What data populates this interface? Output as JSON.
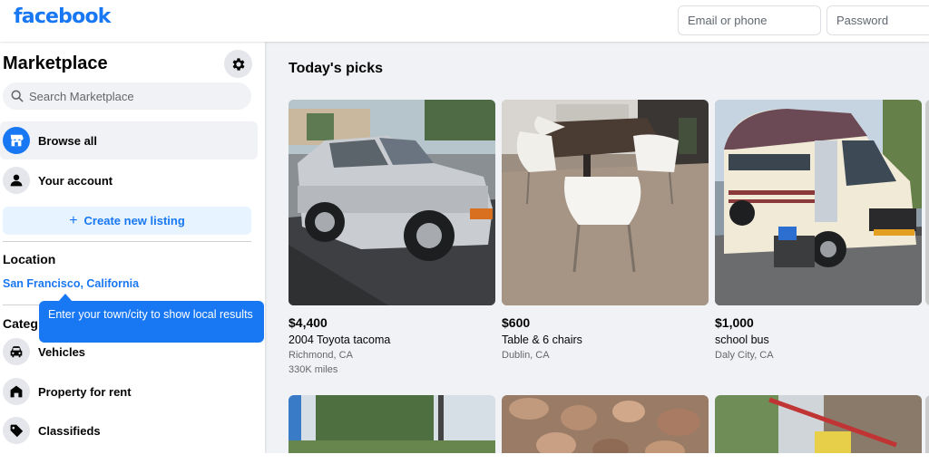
{
  "header": {
    "logo": "facebook",
    "email_placeholder": "Email or phone",
    "password_placeholder": "Password"
  },
  "sidebar": {
    "title": "Marketplace",
    "search_placeholder": "Search Marketplace",
    "nav": [
      {
        "label": "Browse all",
        "icon": "storefront-icon"
      },
      {
        "label": "Your account",
        "icon": "person-icon"
      }
    ],
    "create_label": "Create new listing",
    "location_title": "Location",
    "location_value": "San Francisco, California",
    "categories_title": "Categ",
    "categories": [
      {
        "label": "Vehicles",
        "icon": "car-icon"
      },
      {
        "label": "Property for rent",
        "icon": "house-icon"
      },
      {
        "label": "Classifieds",
        "icon": "tag-icon"
      }
    ],
    "tooltip": "Enter your town/city to show local results"
  },
  "main": {
    "title": "Today's picks",
    "listings": [
      {
        "price": "$4,400",
        "title": "2004 Toyota tacoma",
        "location": "Richmond, CA",
        "mileage": "330K miles"
      },
      {
        "price": "$600",
        "title": "Table & 6 chairs",
        "location": "Dublin, CA",
        "mileage": ""
      },
      {
        "price": "$1,000",
        "title": "school bus",
        "location": "Daly City, CA",
        "mileage": ""
      }
    ]
  },
  "colors": {
    "brand": "#1877f2",
    "page_bg": "#f0f2f5",
    "secondary_text": "#65676b"
  }
}
